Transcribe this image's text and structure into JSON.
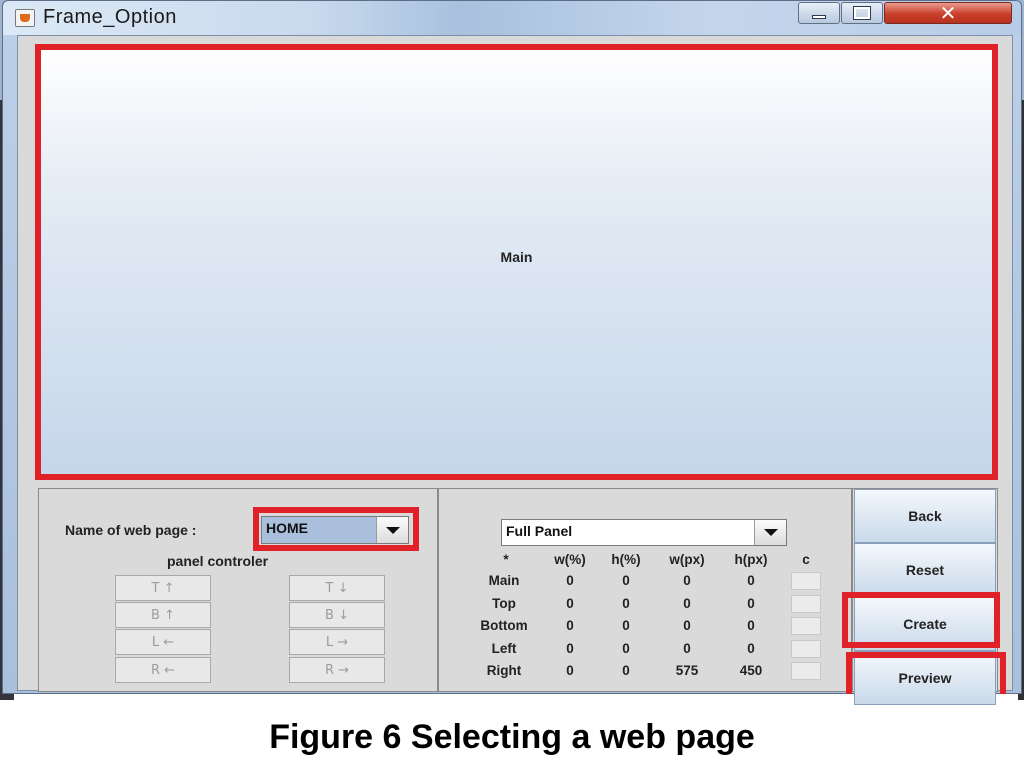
{
  "window": {
    "title": "Frame_Option",
    "controls": {
      "minimize": "minimize-icon",
      "maximize": "maximize-icon",
      "close": "✕"
    }
  },
  "main_panel": {
    "label": "Main"
  },
  "left_panel": {
    "name_label": "Name of web page :",
    "page_select": {
      "value": "HOME"
    },
    "controller_title": "panel controler",
    "buttons": [
      {
        "label": "T ↑"
      },
      {
        "label": "T ↓"
      },
      {
        "label": "B ↑"
      },
      {
        "label": "B ↓"
      },
      {
        "label": "L ←"
      },
      {
        "label": "L →"
      },
      {
        "label": "R ←"
      },
      {
        "label": "R →"
      }
    ]
  },
  "middle_panel": {
    "panel_select": {
      "value": "Full Panel"
    },
    "columns": [
      "*",
      "w(%)",
      "h(%)",
      "w(px)",
      "h(px)",
      "c"
    ],
    "rows": [
      {
        "name": "Main",
        "w_pct": "0",
        "h_pct": "0",
        "w_px": "0",
        "h_px": "0"
      },
      {
        "name": "Top",
        "w_pct": "0",
        "h_pct": "0",
        "w_px": "0",
        "h_px": "0"
      },
      {
        "name": "Bottom",
        "w_pct": "0",
        "h_pct": "0",
        "w_px": "0",
        "h_px": "0"
      },
      {
        "name": "Left",
        "w_pct": "0",
        "h_pct": "0",
        "w_px": "0",
        "h_px": "0"
      },
      {
        "name": "Right",
        "w_pct": "0",
        "h_pct": "0",
        "w_px": "575",
        "h_px": "450"
      }
    ]
  },
  "right_panel": {
    "buttons": [
      {
        "label": "Back"
      },
      {
        "label": "Reset"
      },
      {
        "label": "Create"
      },
      {
        "label": "Preview"
      }
    ]
  },
  "caption": "Figure 6  Selecting a web page",
  "colors": {
    "highlight": "#e02127",
    "window_frame": "#a9c0dc",
    "panel_bg": "#dadada"
  }
}
